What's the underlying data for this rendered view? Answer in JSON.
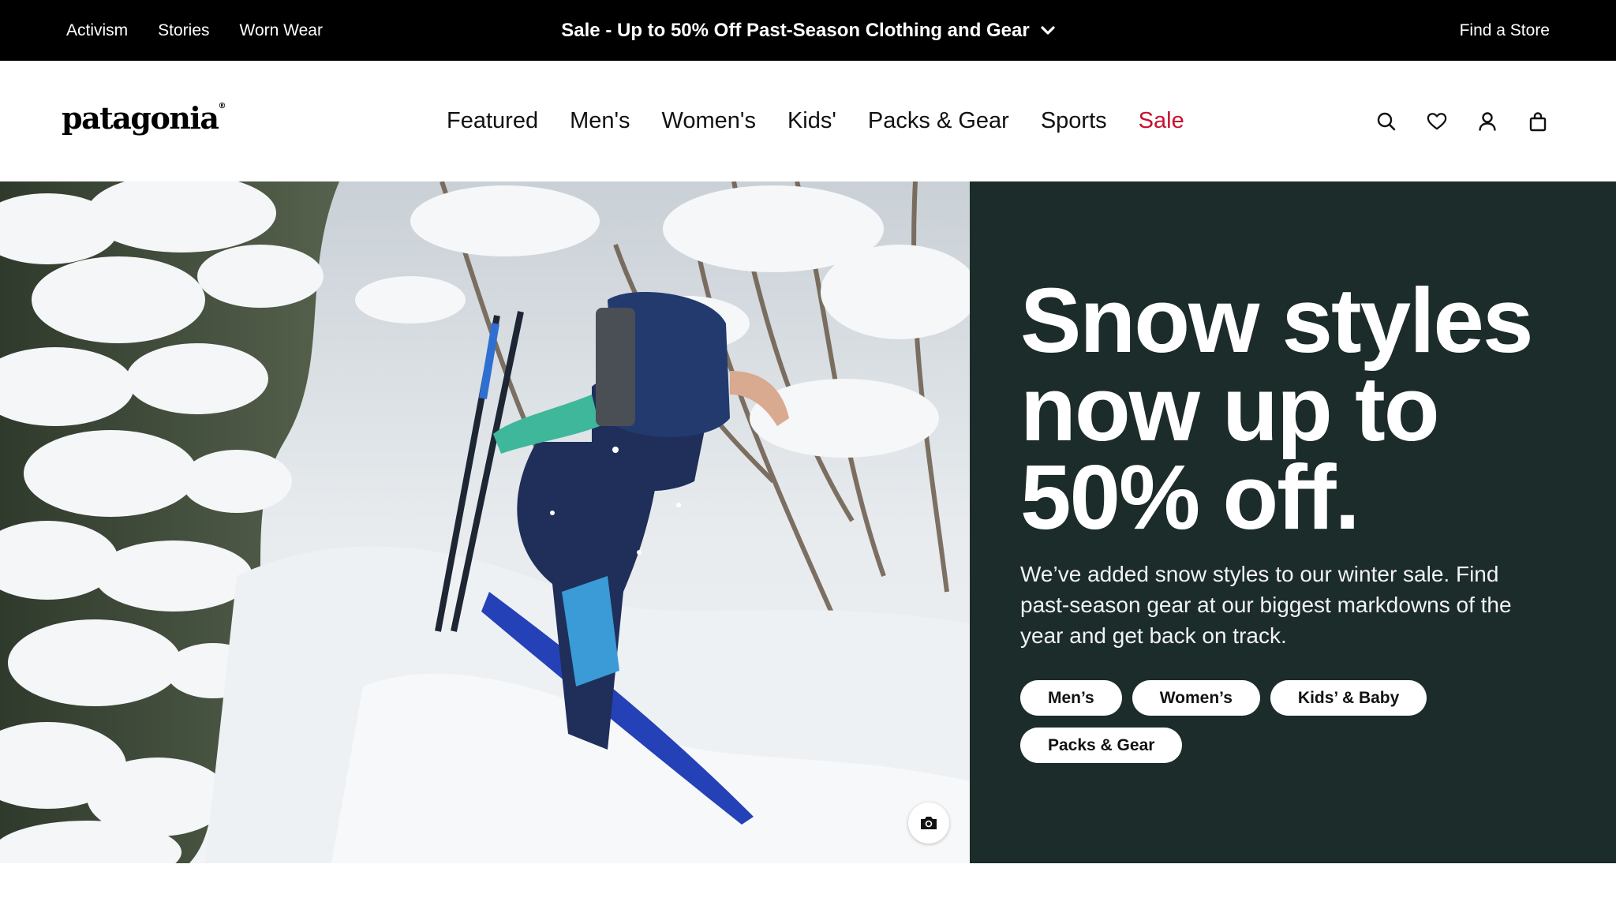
{
  "topbar": {
    "links": [
      "Activism",
      "Stories",
      "Worn Wear"
    ],
    "promo": "Sale - Up to 50% Off Past-Season Clothing and Gear",
    "find_store": "Find a Store",
    "background": "#000000"
  },
  "header": {
    "logo": "patagonia",
    "nav": [
      "Featured",
      "Men's",
      "Women's",
      "Kids'",
      "Packs & Gear",
      "Sports",
      "Sale"
    ],
    "sale_color": "#c8102e",
    "icons": [
      "search-icon",
      "heart-icon",
      "account-icon",
      "bag-icon"
    ]
  },
  "hero": {
    "title": "Snow styles now up to 50% off.",
    "text": "We’ve added snow styles to our winter sale. Find past-season gear at our biggest markdowns of the year and get back on track.",
    "buttons": [
      "Men’s",
      "Women’s",
      "Kids’ & Baby",
      "Packs & Gear"
    ],
    "panel_color": "#1b2c2a",
    "photo_icon": "camera-icon"
  }
}
